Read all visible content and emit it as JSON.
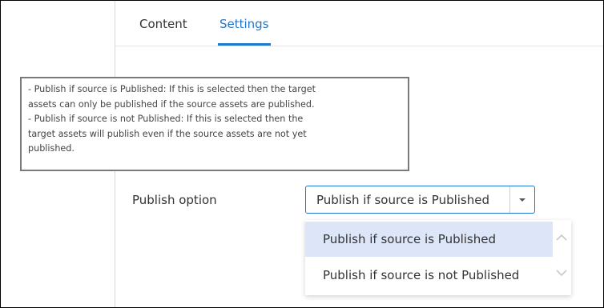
{
  "tabs": [
    {
      "label": "Content",
      "active": false
    },
    {
      "label": "Settings",
      "active": true
    }
  ],
  "tooltip": {
    "lines": [
      "- Publish if source is Published: If this is selected then the target",
      "assets can only be published if the source assets are published.",
      "- Publish if source is not Published: If this is selected then the",
      "target assets will publish even if the source assets are not yet",
      "published."
    ]
  },
  "publish_option": {
    "label": "Publish option",
    "selected": "Publish if source is Published",
    "options": [
      "Publish if source is Published",
      "Publish if source is not Published"
    ],
    "highlighted_index": 0
  },
  "icons": {
    "select_arrow": "caret-down-icon",
    "scroll_up": "chevron-up-icon",
    "scroll_down": "chevron-down-icon"
  },
  "colors": {
    "accent": "#1f78d1",
    "highlight": "#dce6f8",
    "tooltip_border": "#7a7a7a"
  }
}
